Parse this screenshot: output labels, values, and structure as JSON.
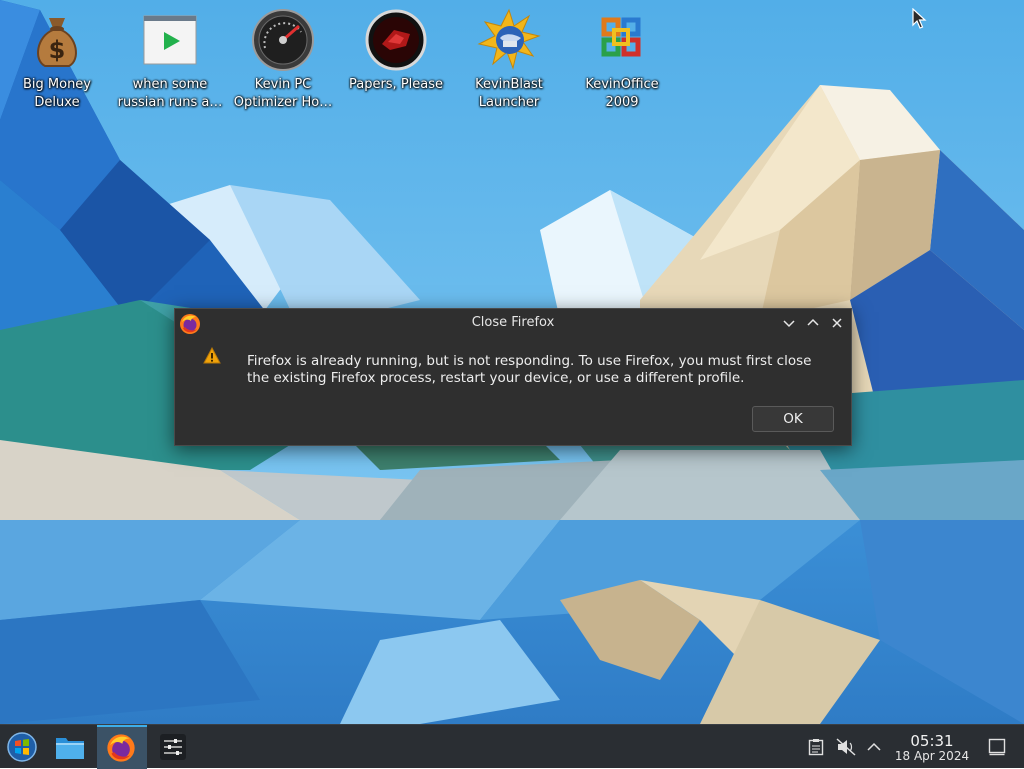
{
  "desktop": {
    "icons": [
      {
        "label": "Big Money Deluxe",
        "icon": "money-bag-icon"
      },
      {
        "label": "when some russian runs a…",
        "icon": "video-file-icon"
      },
      {
        "label": "Kevin PC Optimizer Ho…",
        "icon": "speedometer-gauge-icon"
      },
      {
        "label": "Papers, Please",
        "icon": "papers-please-seal-icon"
      },
      {
        "label": "KevinBlast Launcher",
        "icon": "sun-globe-icon"
      },
      {
        "label": "KevinOffice 2009",
        "icon": "office-logo-icon"
      }
    ]
  },
  "dialog": {
    "title": "Close Firefox",
    "message": "Firefox is already running, but is not responding. To use Firefox, you must first close the existing Firefox process, restart your device, or use a different profile.",
    "ok_label": "OK",
    "icon": "warning-icon"
  },
  "taskbar": {
    "start_icon": "start-orb-icon",
    "launchers": [
      "file-manager-icon",
      "firefox-icon",
      "settings-sliders-icon"
    ],
    "active_task": "firefox",
    "tray_icons": [
      "clipboard-icon",
      "speaker-muted-icon",
      "chevron-up-icon"
    ],
    "time": "05:31",
    "date": "18 Apr 2024",
    "show_desktop_icon": "show-desktop-icon"
  },
  "colors": {
    "taskbar_bg": "#2a2e33",
    "dialog_bg": "#2f2f2f",
    "accent": "#3daee9",
    "warning": "#f0a30a"
  }
}
